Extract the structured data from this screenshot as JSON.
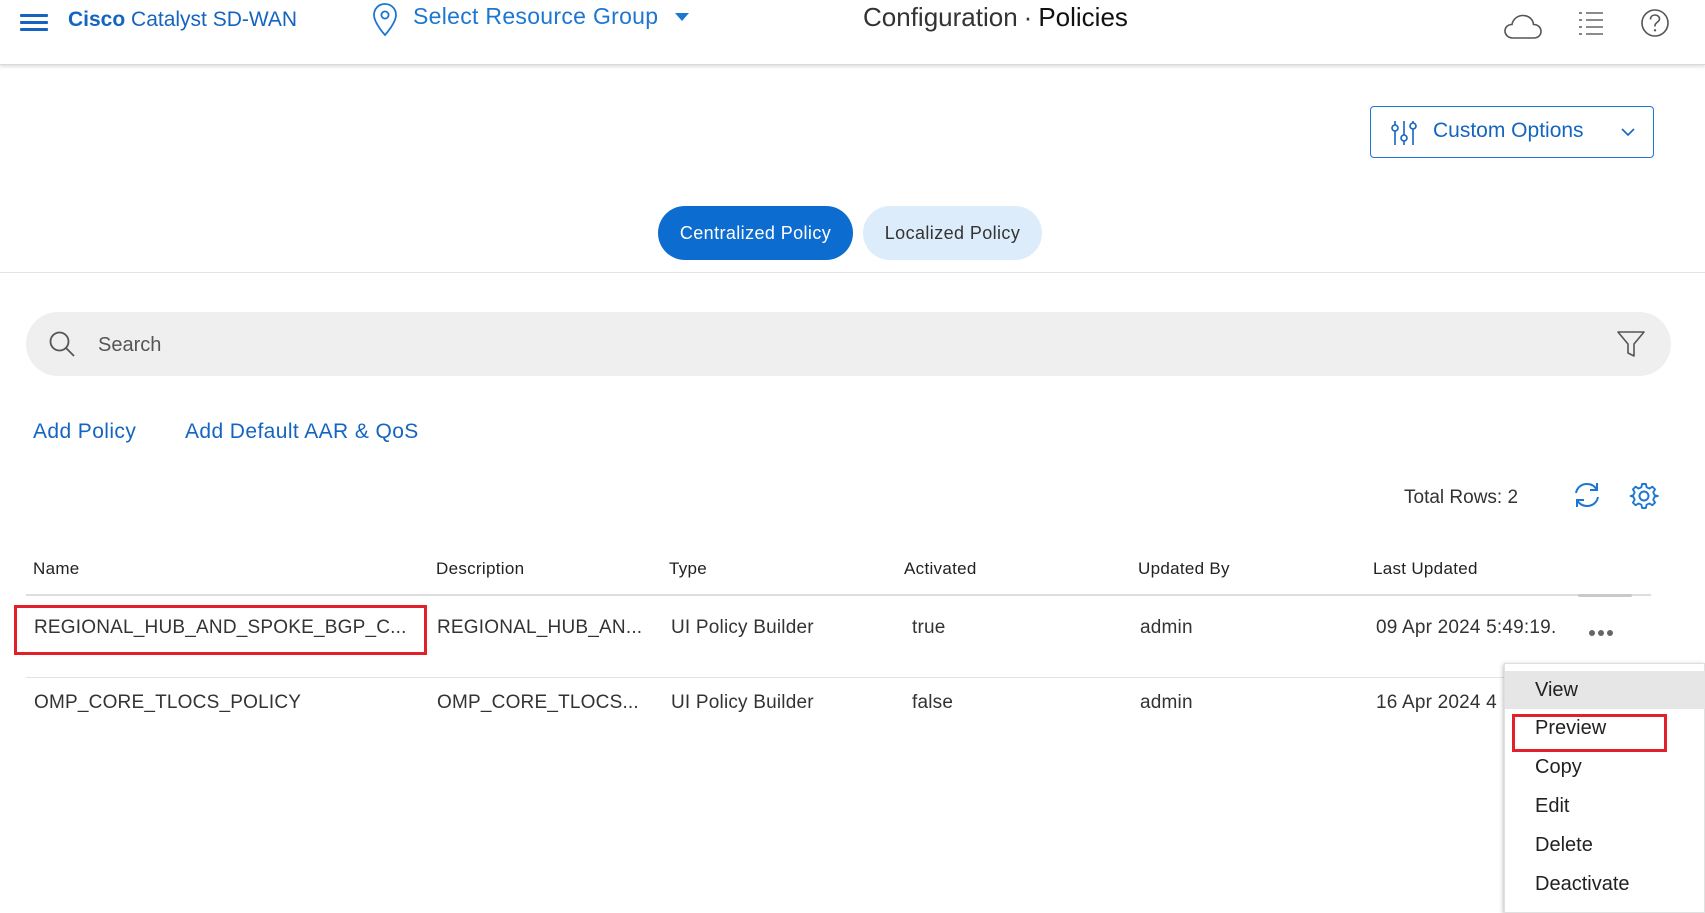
{
  "header": {
    "brand_strong": "Cisco",
    "brand_rest": " Catalyst SD-WAN",
    "resource_group": "Select Resource Group",
    "title_section": "Configuration",
    "title_separator": "·",
    "title_page": "Policies",
    "icons": [
      "menu-icon",
      "location-pin-icon",
      "cloud-icon",
      "task-list-icon",
      "help-icon"
    ]
  },
  "toolbar": {
    "custom_options_label": "Custom Options"
  },
  "tabs": [
    {
      "label": "Centralized Policy",
      "active": true
    },
    {
      "label": "Localized Policy",
      "active": false
    }
  ],
  "search": {
    "placeholder": "Search"
  },
  "actions": {
    "add_policy": "Add Policy",
    "add_default": "Add Default AAR & QoS"
  },
  "table": {
    "total_rows": "Total Rows: 2",
    "columns": [
      "Name",
      "Description",
      "Type",
      "Activated",
      "Updated By",
      "Last Updated"
    ],
    "rows": [
      {
        "name": "REGIONAL_HUB_AND_SPOKE_BGP_C...",
        "description": "REGIONAL_HUB_AN...",
        "type": "UI Policy Builder",
        "activated": "true",
        "updated_by": "admin",
        "last_updated": "09 Apr 2024 5:49:19."
      },
      {
        "name": "OMP_CORE_TLOCS_POLICY",
        "description": "OMP_CORE_TLOCS...",
        "type": "UI Policy Builder",
        "activated": "false",
        "updated_by": "admin",
        "last_updated": "16 Apr 2024 4"
      }
    ]
  },
  "context_menu": {
    "items": [
      "View",
      "Preview",
      "Copy",
      "Edit",
      "Delete",
      "Deactivate"
    ],
    "hovered": "View"
  },
  "colors": {
    "accent": "#1565c0",
    "active_tab": "#0d6ccf",
    "inactive_tab": "#dcecfb",
    "highlight_box": "#e3202a"
  }
}
